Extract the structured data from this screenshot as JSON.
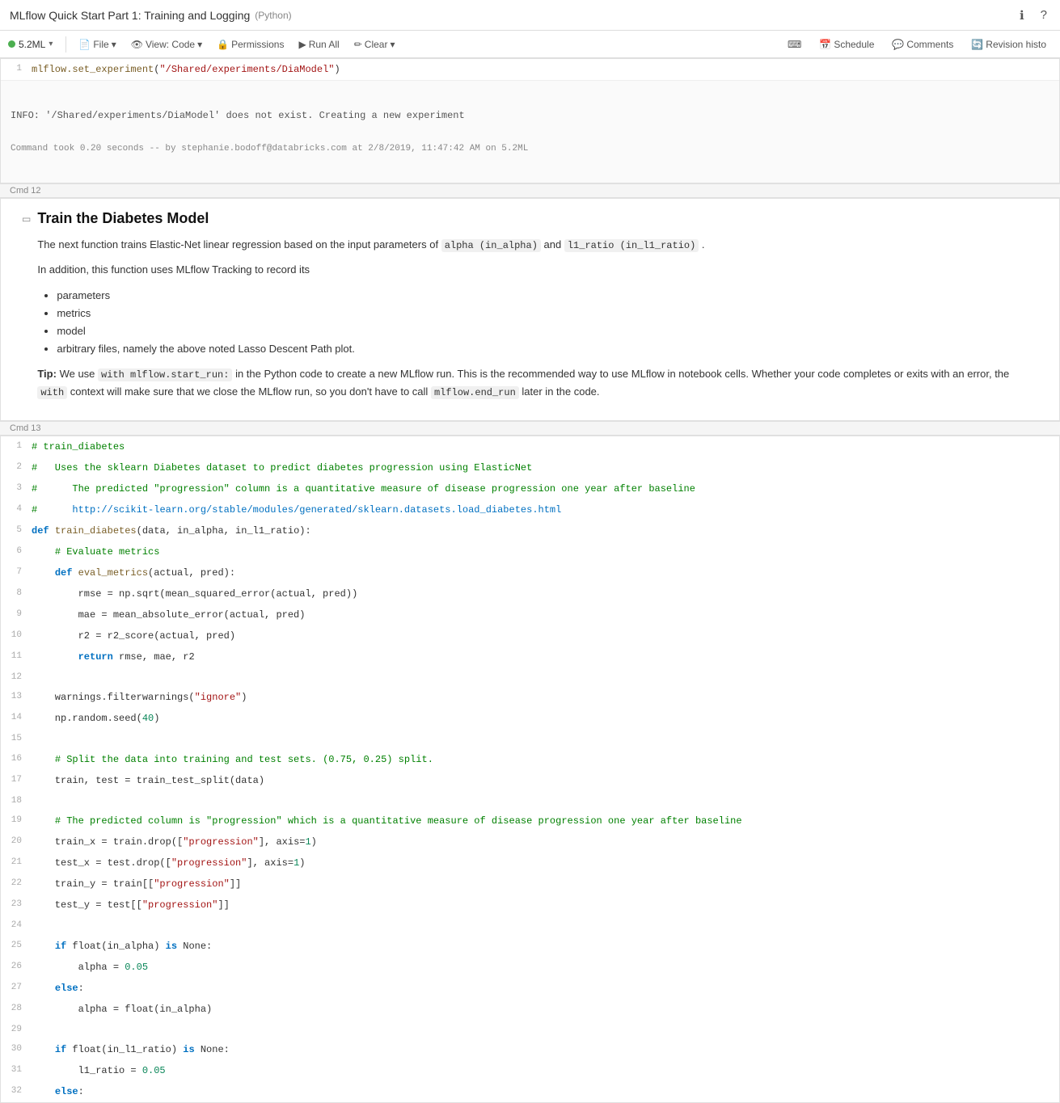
{
  "titleBar": {
    "title": "MLflow Quick Start Part 1: Training and Logging",
    "lang": "(Python)",
    "icons": {
      "info": "ℹ",
      "help": "?"
    }
  },
  "toolbar": {
    "cluster": {
      "dot_color": "#4caf50",
      "name": "5.2ML",
      "arrow": "▾"
    },
    "buttons": {
      "file": "File",
      "view_code": "View: Code",
      "permissions": "Permissions",
      "run_all": "Run All",
      "clear": "Clear"
    },
    "right": {
      "keyboard": "⌨",
      "schedule": "Schedule",
      "comments": "Comments",
      "revision": "Revision histo"
    }
  },
  "cmd12": {
    "label": "Cmd 12",
    "code_line": "mlflow.set_experiment(\"/Shared/experiments/DiaModel\")",
    "output_info": "INFO: '/Shared/experiments/DiaModel' does not exist. Creating a new experiment",
    "output_meta": "Command took 0.20 seconds -- by stephanie.bodoff@databricks.com at 2/8/2019, 11:47:42 AM on 5.2ML"
  },
  "cmd13_label": "Cmd 13",
  "markdownCell": {
    "heading": "Train the Diabetes Model",
    "para1_before": "The next function trains Elastic-Net linear regression based on the input parameters of",
    "para1_code1": "alpha (in_alpha)",
    "para1_mid": "and",
    "para1_code2": "l1_ratio (in_l1_ratio)",
    "para1_after": ".",
    "para2": "In addition, this function uses MLflow Tracking to record its",
    "bullets": [
      "parameters",
      "metrics",
      "model",
      "arbitrary files, namely the above noted Lasso Descent Path plot."
    ],
    "tip_label": "Tip:",
    "tip_code1": "with mlflow.start_run:",
    "tip_mid": "in the Python code to create a new MLflow run. This is the recommended way to use MLflow in notebook cells. Whether your code completes or exits with an error, the",
    "tip_code2": "with",
    "tip_end1": "context will make sure that we close the MLflow run, so you don't have to call",
    "tip_code3": "mlflow.end_run",
    "tip_end2": "later in the code."
  },
  "cmd13": {
    "label": "Cmd 13",
    "lines": [
      {
        "num": 1,
        "text": "# train_diabetes"
      },
      {
        "num": 2,
        "text": "#   Uses the sklearn Diabetes dataset to predict diabetes progression using ElasticNet"
      },
      {
        "num": 3,
        "text": "#      The predicted \"progression\" column is a quantitative measure of disease progression one year after baseline"
      },
      {
        "num": 4,
        "text": "#      http://scikit-learn.org/stable/modules/generated/sklearn.datasets.load_diabetes.html"
      },
      {
        "num": 5,
        "text": "def train_diabetes(data, in_alpha, in_l1_ratio):"
      },
      {
        "num": 6,
        "text": "    # Evaluate metrics"
      },
      {
        "num": 7,
        "text": "    def eval_metrics(actual, pred):"
      },
      {
        "num": 8,
        "text": "        rmse = np.sqrt(mean_squared_error(actual, pred))"
      },
      {
        "num": 9,
        "text": "        mae = mean_absolute_error(actual, pred)"
      },
      {
        "num": 10,
        "text": "        r2 = r2_score(actual, pred)"
      },
      {
        "num": 11,
        "text": "        return rmse, mae, r2"
      },
      {
        "num": 12,
        "text": ""
      },
      {
        "num": 13,
        "text": "    warnings.filterwarnings(\"ignore\")"
      },
      {
        "num": 14,
        "text": "    np.random.seed(40)"
      },
      {
        "num": 15,
        "text": ""
      },
      {
        "num": 16,
        "text": "    # Split the data into training and test sets. (0.75, 0.25) split."
      },
      {
        "num": 17,
        "text": "    train, test = train_test_split(data)"
      },
      {
        "num": 18,
        "text": ""
      },
      {
        "num": 19,
        "text": "    # The predicted column is \"progression\" which is a quantitative measure of disease progression one year after baseline"
      },
      {
        "num": 20,
        "text": "    train_x = train.drop([\"progression\"], axis=1)"
      },
      {
        "num": 21,
        "text": "    test_x = test.drop([\"progression\"], axis=1)"
      },
      {
        "num": 22,
        "text": "    train_y = train[[\"progression\"]]"
      },
      {
        "num": 23,
        "text": "    test_y = test[[\"progression\"]]"
      },
      {
        "num": 24,
        "text": ""
      },
      {
        "num": 25,
        "text": "    if float(in_alpha) is None:"
      },
      {
        "num": 26,
        "text": "        alpha = 0.05"
      },
      {
        "num": 27,
        "text": "    else:"
      },
      {
        "num": 28,
        "text": "        alpha = float(in_alpha)"
      },
      {
        "num": 29,
        "text": ""
      },
      {
        "num": 30,
        "text": "    if float(in_l1_ratio) is None:"
      },
      {
        "num": 31,
        "text": "        l1_ratio = 0.05"
      },
      {
        "num": 32,
        "text": "    else:"
      }
    ]
  }
}
